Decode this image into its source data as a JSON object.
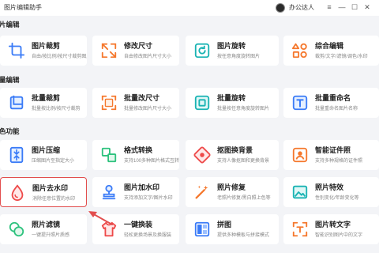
{
  "window": {
    "title": "图片编辑助手",
    "username": "办公达人",
    "controls": {
      "menu": "≡",
      "minimize": "—",
      "maximize": "☐",
      "close": "✕"
    }
  },
  "sections": [
    {
      "title": "片编辑"
    },
    {
      "title": "量编辑"
    },
    {
      "title": "色功能"
    }
  ],
  "cards": [
    {
      "name": "图片裁剪",
      "desc": "自由/按比例/按尺寸裁剪图片",
      "icon": "crop-icon"
    },
    {
      "name": "修改尺寸",
      "desc": "自由修改图片尺寸大小",
      "icon": "resize-icon"
    },
    {
      "name": "图片旋转",
      "desc": "按任意角度旋转图片",
      "icon": "rotate-icon"
    },
    {
      "name": "综合编辑",
      "desc": "裁剪/文字/滤镜/调色/水印",
      "icon": "shapes-icon"
    },
    {
      "name": "批量裁剪",
      "desc": "批量按比例/按尺寸裁剪",
      "icon": "batch-crop-icon"
    },
    {
      "name": "批量改尺寸",
      "desc": "批量修改图片尺寸大小",
      "icon": "batch-resize-icon"
    },
    {
      "name": "批量旋转",
      "desc": "批量按任意角度旋转图片",
      "icon": "batch-rotate-icon"
    },
    {
      "name": "批量重命名",
      "desc": "批量重命名图片名称",
      "icon": "rename-icon"
    },
    {
      "name": "图片压缩",
      "desc": "压缩图片至指定大小",
      "icon": "compress-icon"
    },
    {
      "name": "格式转换",
      "desc": "支持100多种图片格式互转",
      "icon": "convert-icon"
    },
    {
      "name": "抠图换背景",
      "desc": "支持人像抠图和更换背景",
      "icon": "cutout-icon"
    },
    {
      "name": "智能证件照",
      "desc": "支持多种规格的证件照",
      "icon": "id-photo-icon"
    },
    {
      "name": "图片去水印",
      "desc": "消除任意位置的水印",
      "icon": "remove-watermark-icon"
    },
    {
      "name": "图片加水印",
      "desc": "支持添加文字/图片水印",
      "icon": "add-watermark-icon"
    },
    {
      "name": "照片修复",
      "desc": "老照片修复/黑白照上色等",
      "icon": "magic-wand-icon"
    },
    {
      "name": "照片特效",
      "desc": "性别变化/年龄变化等",
      "icon": "photo-effect-icon"
    },
    {
      "name": "照片滤镜",
      "desc": "一键提升照片质感",
      "icon": "filter-icon"
    },
    {
      "name": "一键换装",
      "desc": "轻松更换场景及换服装",
      "icon": "clothes-icon"
    },
    {
      "name": "拼图",
      "desc": "提供多种模板与拼接模式",
      "icon": "collage-icon"
    },
    {
      "name": "图片转文字",
      "desc": "智能识别图片中的文字",
      "icon": "ocr-icon"
    }
  ],
  "colors": {
    "accent_blue": "#3a7bf7",
    "accent_orange": "#f5782d",
    "accent_green": "#2ec27e",
    "accent_teal": "#19b3b3",
    "accent_purple": "#7b61ff",
    "accent_red": "#ee4a4a",
    "highlight": "#e24e4e"
  }
}
